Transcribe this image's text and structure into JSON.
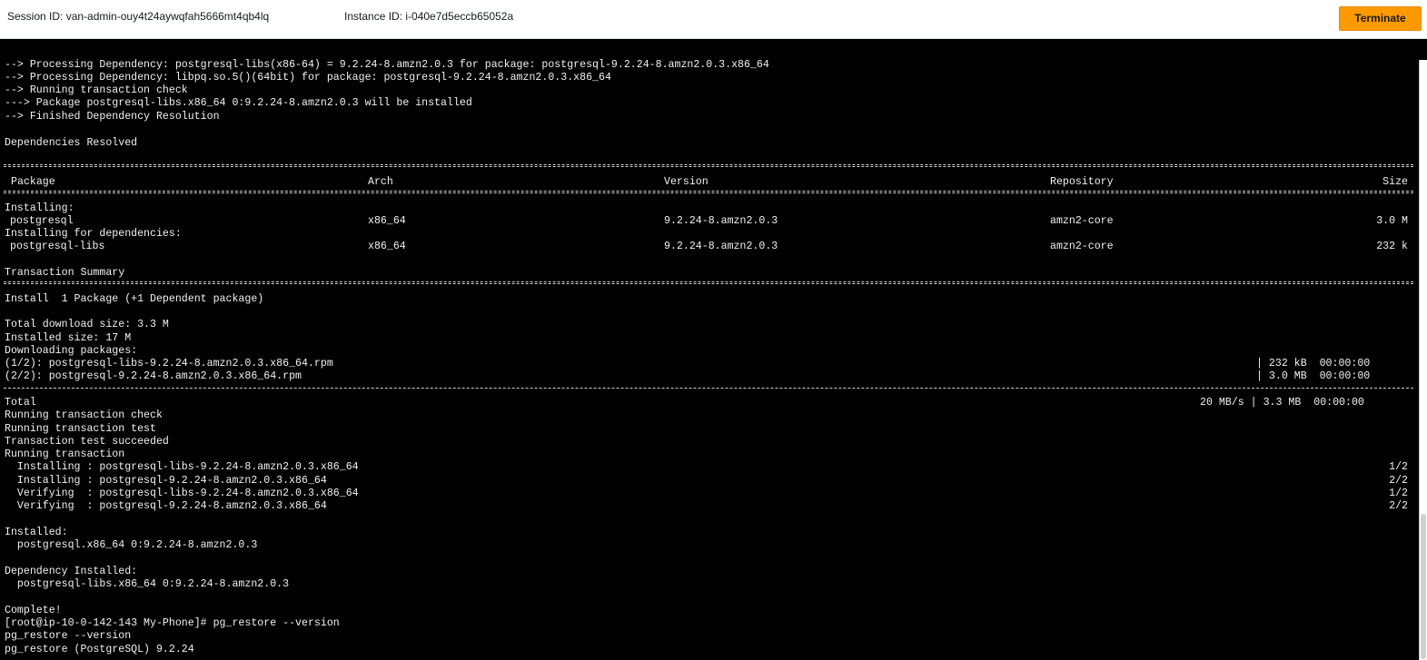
{
  "header": {
    "session_label": "Session ID: van-admin-ouy4t24aywqfah5666mt4qb4lq",
    "instance_label": "Instance ID: i-040e7d5eccb65052a",
    "terminate_label": "Terminate",
    "terminate_color": "#ff9900"
  },
  "terminal": {
    "pre_lines": [
      "--> Processing Dependency: postgresql-libs(x86-64) = 9.2.24-8.amzn2.0.3 for package: postgresql-9.2.24-8.amzn2.0.3.x86_64",
      "--> Processing Dependency: libpq.so.5()(64bit) for package: postgresql-9.2.24-8.amzn2.0.3.x86_64",
      "--> Running transaction check",
      "---> Package postgresql-libs.x86_64 0:9.2.24-8.amzn2.0.3 will be installed",
      "--> Finished Dependency Resolution",
      "",
      "Dependencies Resolved"
    ],
    "table": {
      "headers": [
        "Package",
        "Arch",
        "Version",
        "Repository",
        "Size"
      ],
      "installing_label": "Installing:",
      "installing_deps_label": "Installing for dependencies:",
      "rows": [
        {
          "package": "postgresql",
          "arch": "x86_64",
          "version": "9.2.24-8.amzn2.0.3",
          "repository": "amzn2-core",
          "size": "3.0 M"
        },
        {
          "package": "postgresql-libs",
          "arch": "x86_64",
          "version": "9.2.24-8.amzn2.0.3",
          "repository": "amzn2-core",
          "size": "232 k"
        }
      ]
    },
    "summary_title": "Transaction Summary",
    "summary_line": "Install  1 Package (+1 Dependent package)",
    "download_lines": [
      "Total download size: 3.3 M",
      "Installed size: 17 M",
      "Downloading packages:"
    ],
    "downloads": [
      {
        "name": "(1/2): postgresql-libs-9.2.24-8.amzn2.0.3.x86_64.rpm",
        "stats": "| 232 kB  00:00:00"
      },
      {
        "name": "(2/2): postgresql-9.2.24-8.amzn2.0.3.x86_64.rpm",
        "stats": "| 3.0 MB  00:00:00"
      }
    ],
    "total": {
      "label": "Total",
      "stats": "20 MB/s | 3.3 MB  00:00:00"
    },
    "run_lines": [
      "Running transaction check",
      "Running transaction test",
      "Transaction test succeeded",
      "Running transaction"
    ],
    "steps": [
      {
        "text": "  Installing : postgresql-libs-9.2.24-8.amzn2.0.3.x86_64",
        "count": "1/2"
      },
      {
        "text": "  Installing : postgresql-9.2.24-8.amzn2.0.3.x86_64",
        "count": "2/2"
      },
      {
        "text": "  Verifying  : postgresql-libs-9.2.24-8.amzn2.0.3.x86_64",
        "count": "1/2"
      },
      {
        "text": "  Verifying  : postgresql-9.2.24-8.amzn2.0.3.x86_64",
        "count": "2/2"
      }
    ],
    "post_lines": [
      "",
      "Installed:",
      "  postgresql.x86_64 0:9.2.24-8.amzn2.0.3",
      "",
      "Dependency Installed:",
      "  postgresql-libs.x86_64 0:9.2.24-8.amzn2.0.3",
      "",
      "Complete!",
      "[root@ip-10-0-142-143 My-Phone]# pg_restore --version",
      "pg_restore --version",
      "pg_restore (PostgreSQL) 9.2.24"
    ]
  }
}
